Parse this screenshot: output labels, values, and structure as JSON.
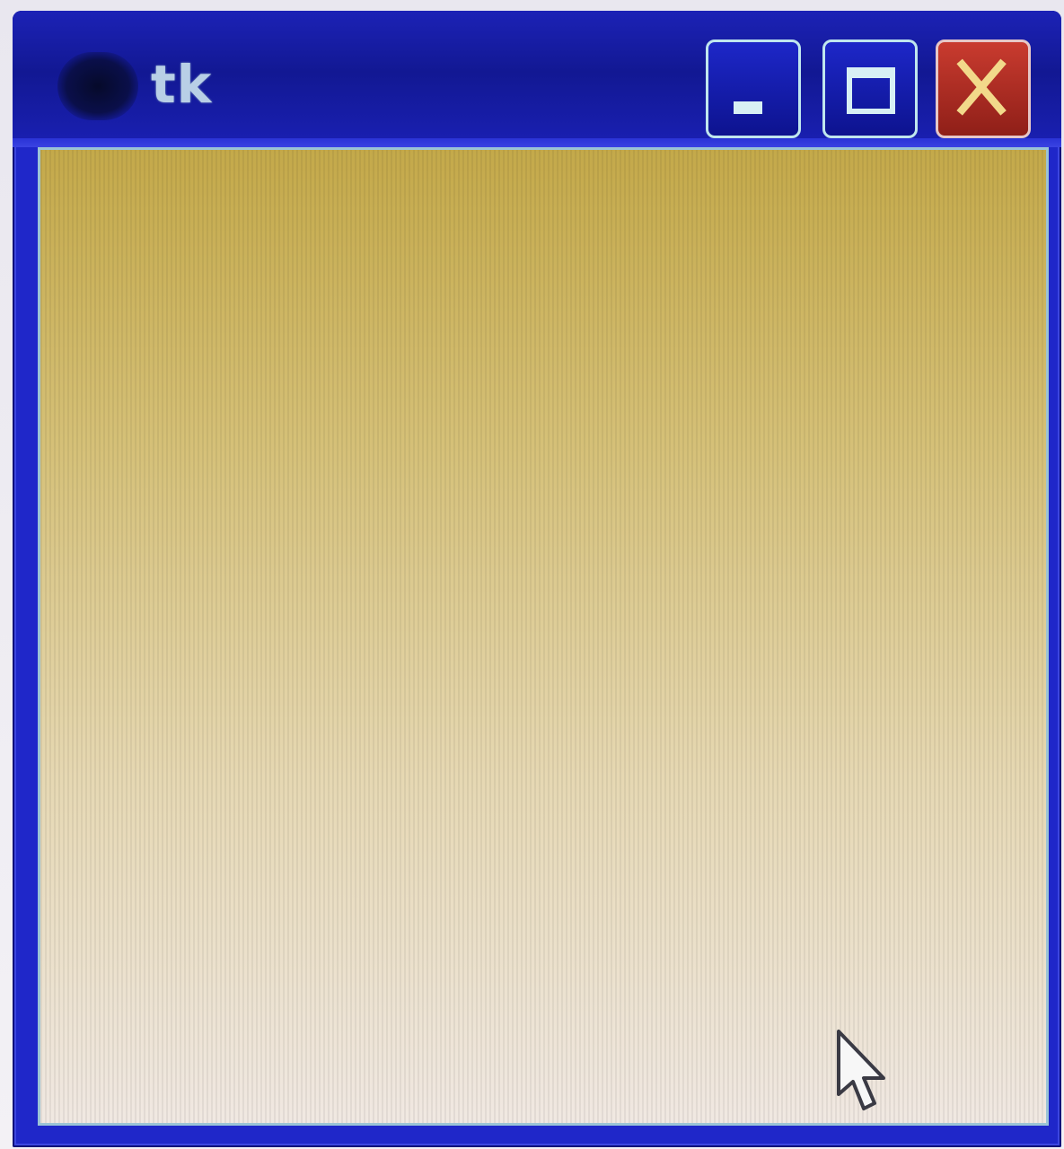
{
  "window": {
    "title": "tk"
  },
  "colors": {
    "titlebar": "#121893",
    "frame": "#1f27c9",
    "close_button": "#c93b2f",
    "client_top": "#c4a94a",
    "client_bottom": "#f0e8e2"
  },
  "icons": {
    "app": "tk-app-icon",
    "minimize": "minimize-icon",
    "maximize": "maximize-icon",
    "close": "close-icon",
    "cursor": "mouse-pointer-icon"
  }
}
